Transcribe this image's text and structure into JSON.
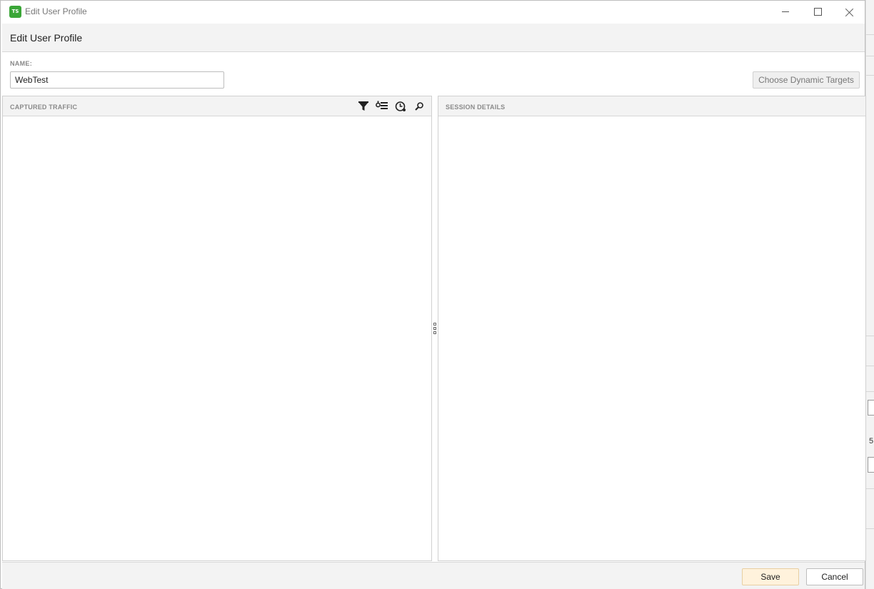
{
  "window": {
    "title": "Edit User Profile",
    "app_icon_text": "TS",
    "app_icon_color": "#3aa637"
  },
  "header": {
    "title": "Edit User Profile"
  },
  "form": {
    "name_label": "NAME:",
    "name_value": "WebTest",
    "dynamic_targets_label": "Choose Dynamic Targets"
  },
  "captured_traffic": {
    "title": "CAPTURED TRAFFIC",
    "toolbar_icons": [
      "filter-icon",
      "list-settings-icon",
      "clock-icon",
      "search-icon"
    ]
  },
  "session_details": {
    "title": "SESSION DETAILS"
  },
  "footer": {
    "save_label": "Save",
    "cancel_label": "Cancel",
    "save_color": "#fff2dc"
  },
  "background": {
    "visible_digit": "5",
    "accent_color": "#e07b00"
  }
}
